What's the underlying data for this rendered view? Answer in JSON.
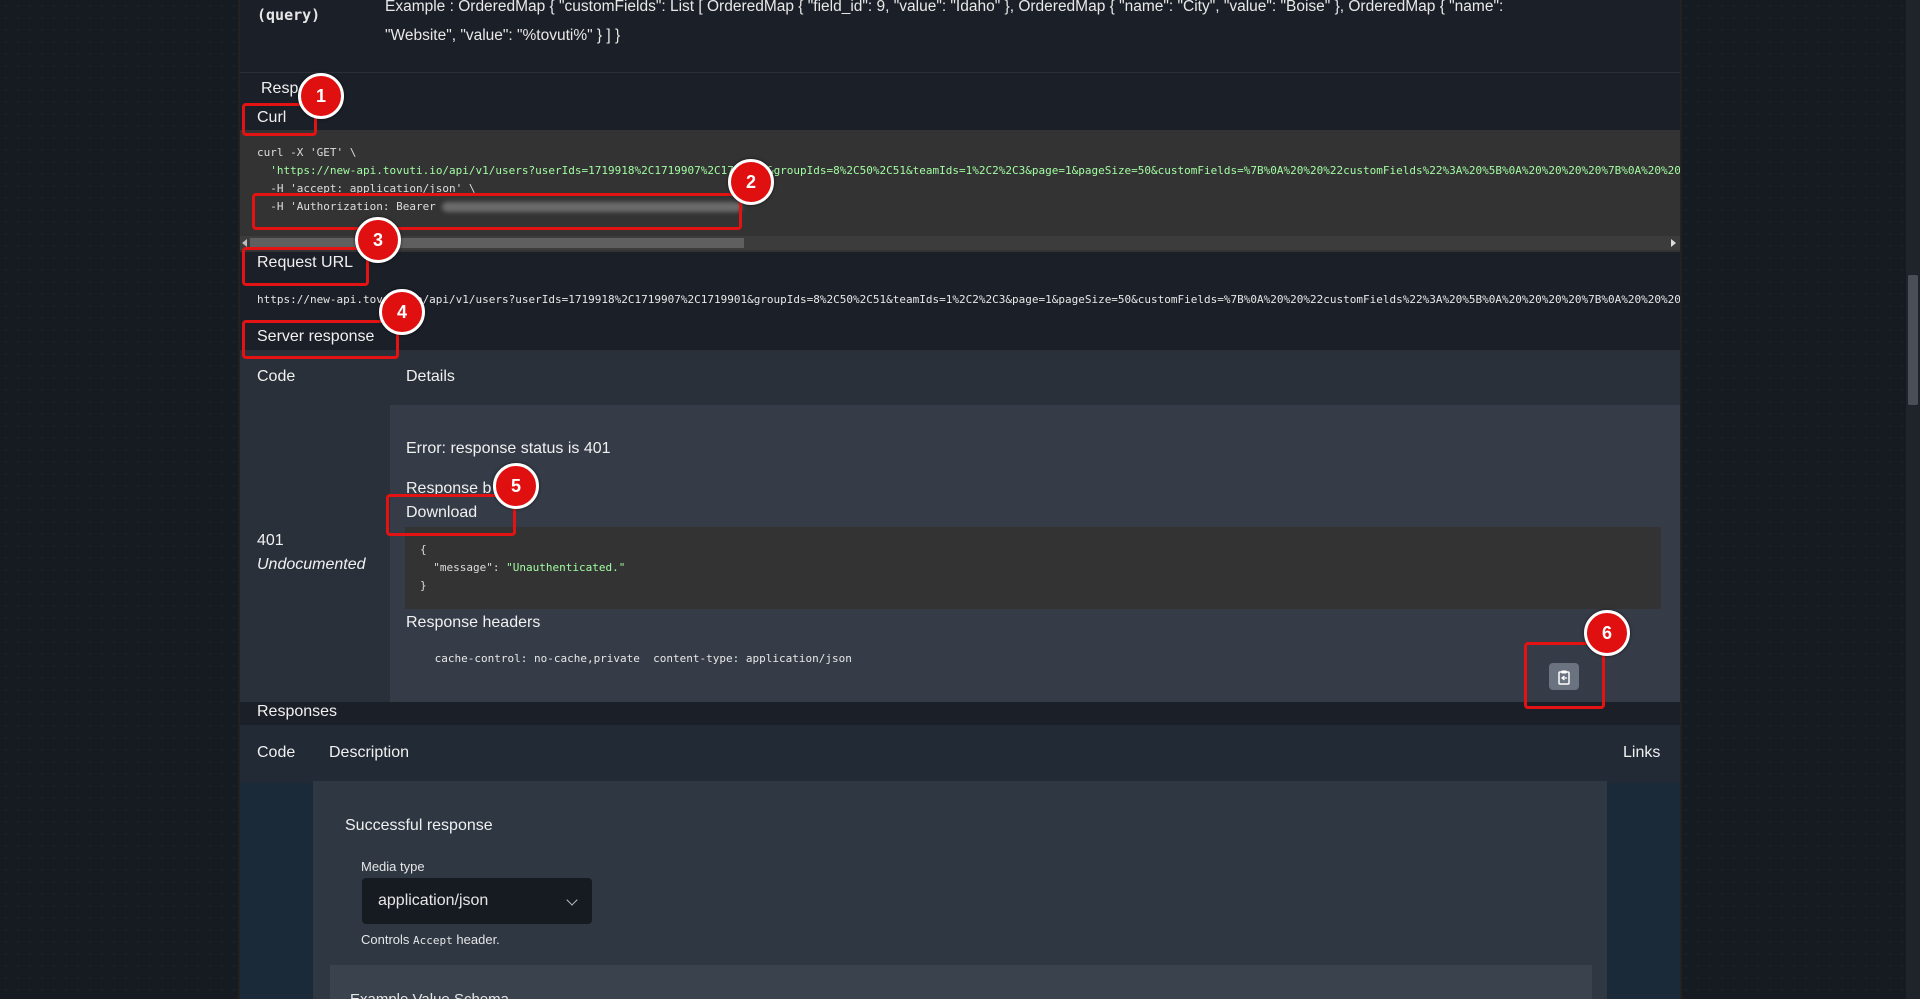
{
  "param": {
    "name_line": "(query)",
    "example_line1": "Example : OrderedMap { \"customFields\": List [ OrderedMap { \"field_id\": 9, \"value\": \"Idaho\" }, OrderedMap { \"name\": \"City\", \"value\": \"Boise\" }, OrderedMap { \"name\":",
    "example_line2": "\"Website\", \"value\": \"%tovuti%\" } ] }"
  },
  "responses_section_label": "Resp",
  "curl": {
    "label": "Curl",
    "line1": "curl -X 'GET' \\",
    "line2_url": "'https://new-api.tovuti.io/api/v1/users?userIds=1719918%2C1719907%2C1719901&groupIds=8%2C50%2C51&teamIds=1%2C2%2C3&page=1&pageSize=50&customFields=%7B%0A%20%20%22customFields%22%3A%20%5B%0A%20%20%20%20%7B%0A%20%20",
    "line3": "  -H 'accept: application/json' \\",
    "line4_prefix": "  -H 'Authorization: Bearer "
  },
  "request_url": {
    "label": "Request URL",
    "value": "https://new-api.tovuti.io/api/v1/users?userIds=1719918%2C1719907%2C1719901&groupIds=8%2C50%2C51&teamIds=1%2C2%2C3&page=1&pageSize=50&customFields=%7B%0A%20%20%22customFields%22%3A%20%5B%0A%20%20%20%20%7B%0A%20%20%20%20"
  },
  "server_response": {
    "label": "Server response",
    "col_code": "Code",
    "col_details": "Details",
    "code": "401",
    "code_note": "Undocumented",
    "error": "Error: response status is 401",
    "response_body_label": "Response b",
    "download_label": "Download",
    "json_line1": "{",
    "json_key": "\"message\"",
    "json_value": "\"Unauthenticated.\"",
    "json_line3": "}",
    "headers_label": "Response headers",
    "headers_value": " cache-control: no-cache,private  content-type: application/json "
  },
  "responses": {
    "title": "Responses",
    "col_code": "Code",
    "col_description": "Description",
    "col_links": "Links",
    "success_label": "Successful response",
    "media_type_label": "Media type",
    "media_type_value": "application/json",
    "controls_prefix": "Controls",
    "controls_code": "Accept",
    "controls_suffix": "header.",
    "example_tabs": "Example Value Schema"
  },
  "annotations": [
    "1",
    "2",
    "3",
    "4",
    "5",
    "6"
  ],
  "colors": {
    "annotation_red": "#e01010",
    "code_string_green": "#a2fca2",
    "panel_bg": "#1b1f27"
  }
}
